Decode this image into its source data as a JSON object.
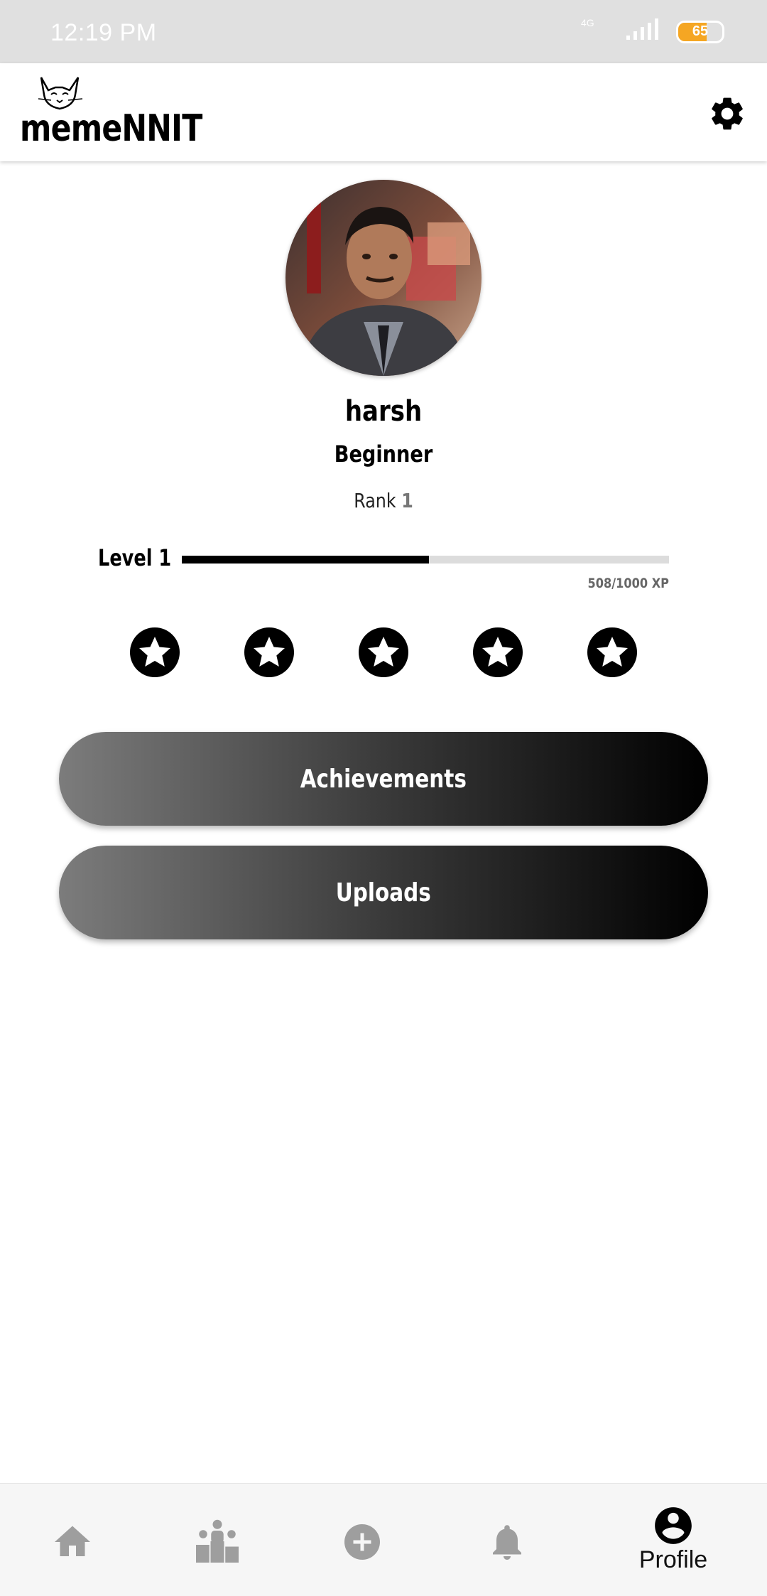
{
  "status_bar": {
    "time": "12:19 PM",
    "network_type": "4G",
    "battery_level": "65",
    "battery_fraction": 0.65
  },
  "app_bar": {
    "logo_text": "memeNNIT",
    "settings_icon": "gear-icon"
  },
  "profile": {
    "username": "harsh",
    "title": "Beginner",
    "rank_label": "Rank",
    "rank_value": "1",
    "level_label": "Level 1",
    "xp_text": "508/1000 XP",
    "xp_fraction": 0.508,
    "stars": [
      "star-icon",
      "star-icon",
      "star-icon",
      "star-icon",
      "star-icon"
    ]
  },
  "actions": {
    "achievements_label": "Achievements",
    "uploads_label": "Uploads"
  },
  "bottom_nav": {
    "items": [
      {
        "icon": "home-icon",
        "label": ""
      },
      {
        "icon": "leaderboard-icon",
        "label": ""
      },
      {
        "icon": "add-circle-icon",
        "label": ""
      },
      {
        "icon": "bell-icon",
        "label": ""
      },
      {
        "icon": "account-circle-icon",
        "label": "Profile",
        "active": true
      }
    ]
  },
  "colors": {
    "accent": "#000000",
    "status_bar_bg": "#e0e0e0",
    "battery": "#f5a623",
    "nav_inactive": "#9e9e9e"
  }
}
